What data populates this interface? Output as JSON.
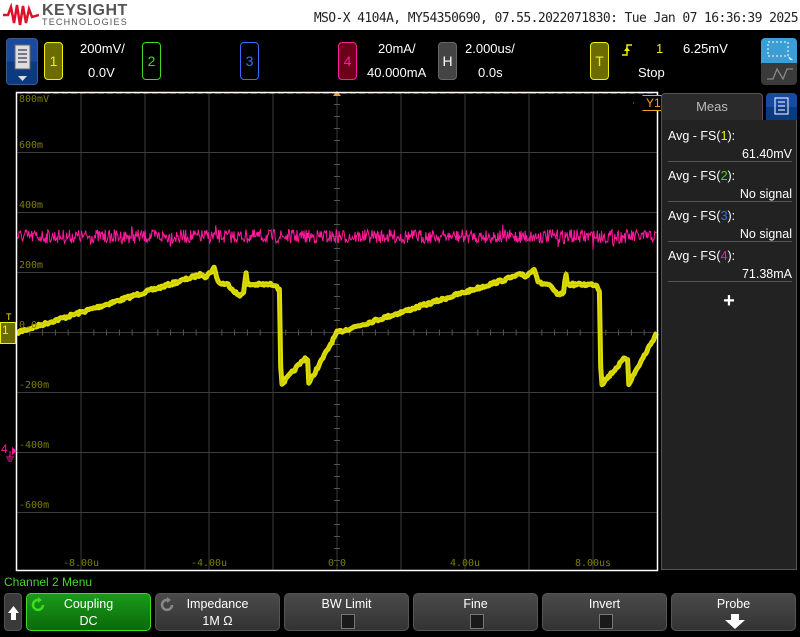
{
  "header": {
    "brand": "KEYSIGHT",
    "brand_sub": "TECHNOLOGIES",
    "title": "MSO-X 4104A, MY54350690, 07.55.2022071830: Tue Jan 07 16:36:39 2025"
  },
  "channels": {
    "ch1": {
      "label": "1",
      "scale": "200mV/",
      "offset": "0.0V",
      "color": "#f0f000"
    },
    "ch2": {
      "label": "2",
      "color": "#3fdc1f"
    },
    "ch3": {
      "label": "3",
      "color": "#3a6cff"
    },
    "ch4": {
      "label": "4",
      "scale": "20mA/",
      "offset": "40.000mA",
      "color": "#ff1a9c"
    }
  },
  "horizontal": {
    "label": "H",
    "scale": "2.000us/",
    "delay": "0.0s"
  },
  "trigger": {
    "label": "T",
    "edge_icon": "rising-edge-icon",
    "source": "1",
    "level": "6.25mV",
    "status": "Stop"
  },
  "axes": {
    "y_labels": [
      "800mV",
      "600m",
      "400m",
      "200m",
      "0.0",
      "-200m",
      "-400m",
      "-600m"
    ],
    "x_labels": [
      "-8.00u",
      "-4.00u",
      "0.0",
      "4.00u",
      "8.00us"
    ],
    "cursor_label": "Y1",
    "ch1_marker": "1",
    "ch4_marker": "4",
    "trigger_marker": "T"
  },
  "meas": {
    "title": "Meas",
    "rows": [
      {
        "name_pre": "Avg - FS(",
        "ch": "1",
        "name_post": "):",
        "value": "61.40mV",
        "color": "#f0f000"
      },
      {
        "name_pre": "Avg - FS(",
        "ch": "2",
        "name_post": "):",
        "value": "No signal",
        "color": "#3fdc1f"
      },
      {
        "name_pre": "Avg - FS(",
        "ch": "3",
        "name_post": "):",
        "value": "No signal",
        "color": "#3a6cff"
      },
      {
        "name_pre": "Avg - FS(",
        "ch": "4",
        "name_post": "):",
        "value": "71.38mA",
        "color": "#ff1a9c"
      }
    ],
    "add": "+"
  },
  "menu_title": "Channel 2 Menu",
  "softkeys": [
    {
      "title": "Coupling",
      "value": "DC"
    },
    {
      "title": "Impedance",
      "value": "1M Ω"
    },
    {
      "title": "BW Limit",
      "checked": false
    },
    {
      "title": "Fine",
      "checked": false
    },
    {
      "title": "Invert",
      "checked": false
    },
    {
      "title": "Probe"
    }
  ],
  "chart_data": {
    "type": "line",
    "x_unit": "us",
    "xlim": [
      -10,
      10
    ],
    "ylim_mV": [
      -800,
      800
    ],
    "series": [
      {
        "channel": "1",
        "unit": "mV",
        "period_us": 10,
        "cycle_points": [
          [
            0,
            0
          ],
          [
            5.8,
            195
          ],
          [
            5.9,
            185
          ],
          [
            6.16,
            215
          ],
          [
            6.3,
            165
          ],
          [
            6.6,
            160
          ],
          [
            6.95,
            120
          ],
          [
            7.1,
            140
          ],
          [
            7.15,
            205
          ],
          [
            7.2,
            160
          ],
          [
            8.1,
            160
          ],
          [
            8.2,
            140
          ],
          [
            8.25,
            -175
          ],
          [
            9.0,
            -85
          ],
          [
            9.1,
            -90
          ],
          [
            9.12,
            -170
          ],
          [
            10,
            0
          ]
        ]
      },
      {
        "channel": "4",
        "unit": "mA",
        "level": 72
      }
    ]
  }
}
